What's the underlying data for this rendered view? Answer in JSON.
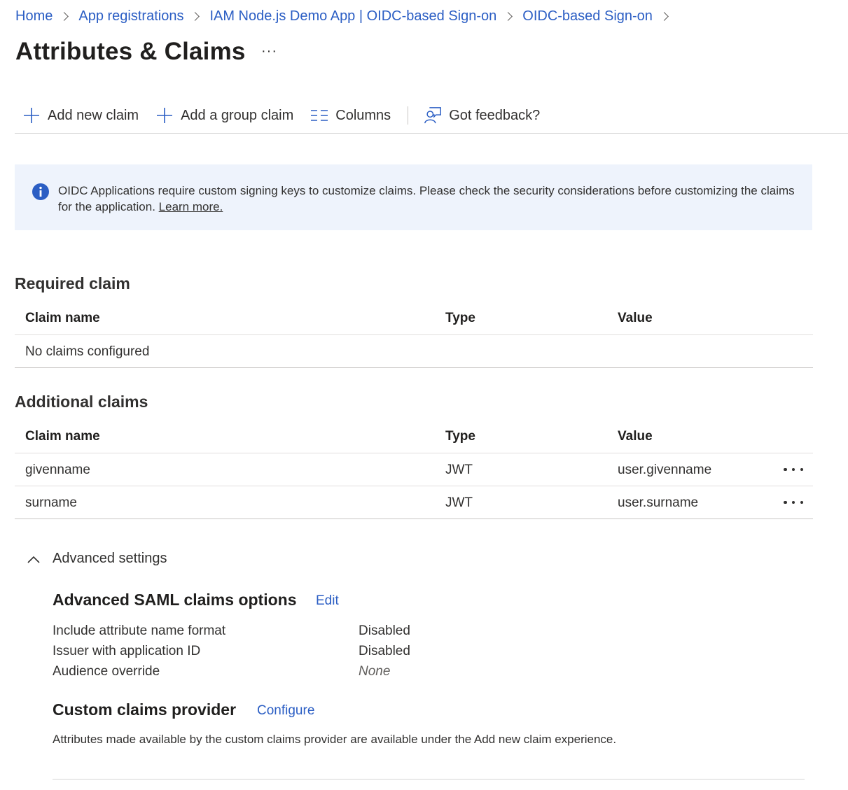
{
  "breadcrumb": {
    "items": [
      "Home",
      "App registrations",
      "IAM Node.js Demo App | OIDC-based Sign-on",
      "OIDC-based Sign-on"
    ]
  },
  "page": {
    "title": "Attributes & Claims",
    "more_label": "···"
  },
  "toolbar": {
    "add_claim": "Add new claim",
    "add_group_claim": "Add a group claim",
    "columns": "Columns",
    "feedback": "Got feedback?"
  },
  "info": {
    "message": "OIDC Applications require custom signing keys to customize claims. Please check the security considerations before customizing the claims for the application.",
    "link": "Learn more."
  },
  "required": {
    "title": "Required claim",
    "headers": {
      "name": "Claim name",
      "type": "Type",
      "value": "Value"
    },
    "empty": "No claims configured"
  },
  "additional": {
    "title": "Additional claims",
    "headers": {
      "name": "Claim name",
      "type": "Type",
      "value": "Value"
    },
    "rows": [
      {
        "name": "givenname",
        "type": "JWT",
        "value": "user.givenname"
      },
      {
        "name": "surname",
        "type": "JWT",
        "value": "user.surname"
      }
    ]
  },
  "advanced": {
    "toggle_label": "Advanced settings",
    "saml": {
      "title": "Advanced SAML claims options",
      "edit": "Edit",
      "items": [
        {
          "label": "Include attribute name format",
          "value": "Disabled"
        },
        {
          "label": "Issuer with application ID",
          "value": "Disabled"
        },
        {
          "label": "Audience override",
          "value": "None"
        }
      ]
    },
    "custom": {
      "title": "Custom claims provider",
      "configure": "Configure",
      "description": "Attributes made available by the custom claims provider are available under the Add new claim experience."
    }
  },
  "colors": {
    "link": "#2b5ec4",
    "info_bg": "#eef3fc",
    "icon_blue": "#2b5ec4"
  }
}
